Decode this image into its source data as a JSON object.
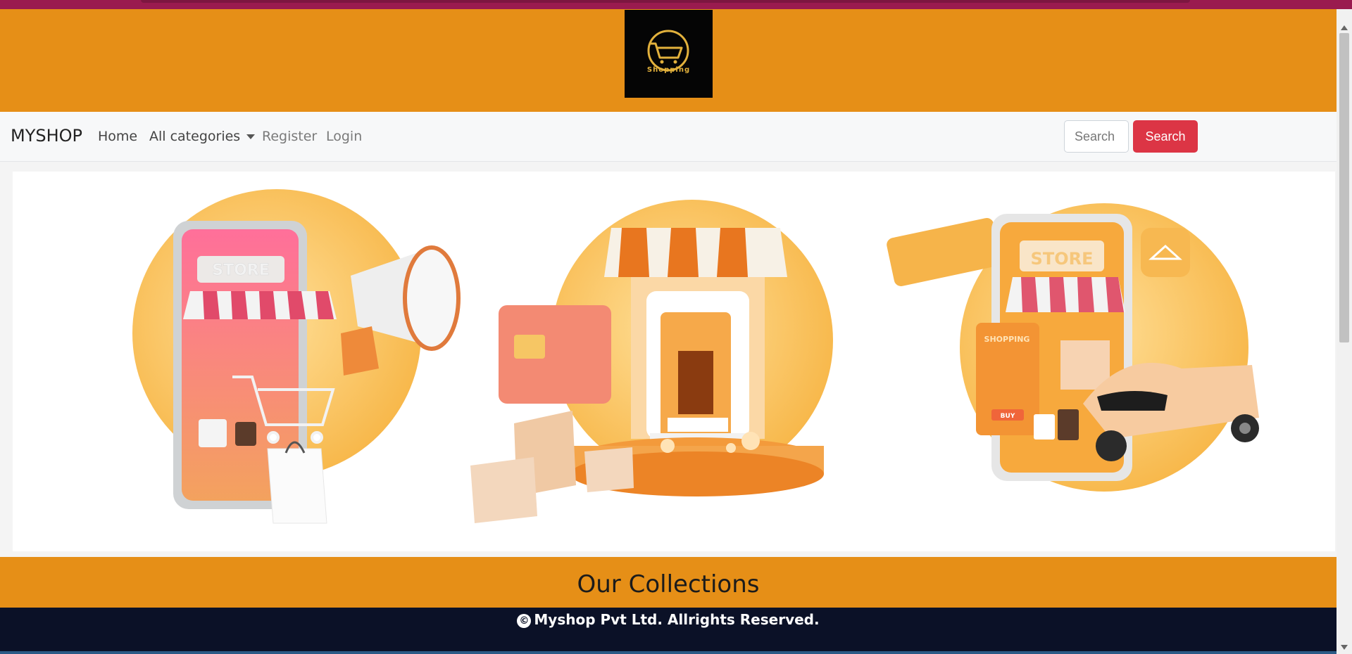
{
  "header": {
    "logo": {
      "icon": "shopping-cart-icon",
      "text": "Shopping",
      "background": "#000000",
      "accent": "#e2b13c"
    },
    "banner_color": "#e68f17"
  },
  "navbar": {
    "brand": "MYSHOP",
    "items": [
      {
        "label": "Home"
      },
      {
        "label": "All categories"
      },
      {
        "label": "Register"
      },
      {
        "label": "Login"
      }
    ],
    "search": {
      "placeholder": "Search",
      "button_label": "Search",
      "button_color": "#dc3545"
    }
  },
  "carousel": {
    "slides": [
      {
        "name": "phone-store-megaphone",
        "sign_text": "STORE"
      },
      {
        "name": "storefront-with-card-and-boxes"
      },
      {
        "name": "phone-store-delivery-scooter",
        "sign_text": "STORE",
        "card_text": "SHOPPING",
        "badge_text": "BUY"
      }
    ]
  },
  "collections": {
    "heading": "Our Collections"
  },
  "footer": {
    "text": "Myshop Pvt Ltd. Allrights Reserved.",
    "icon": "copyright-icon",
    "background": "#0b1127"
  }
}
